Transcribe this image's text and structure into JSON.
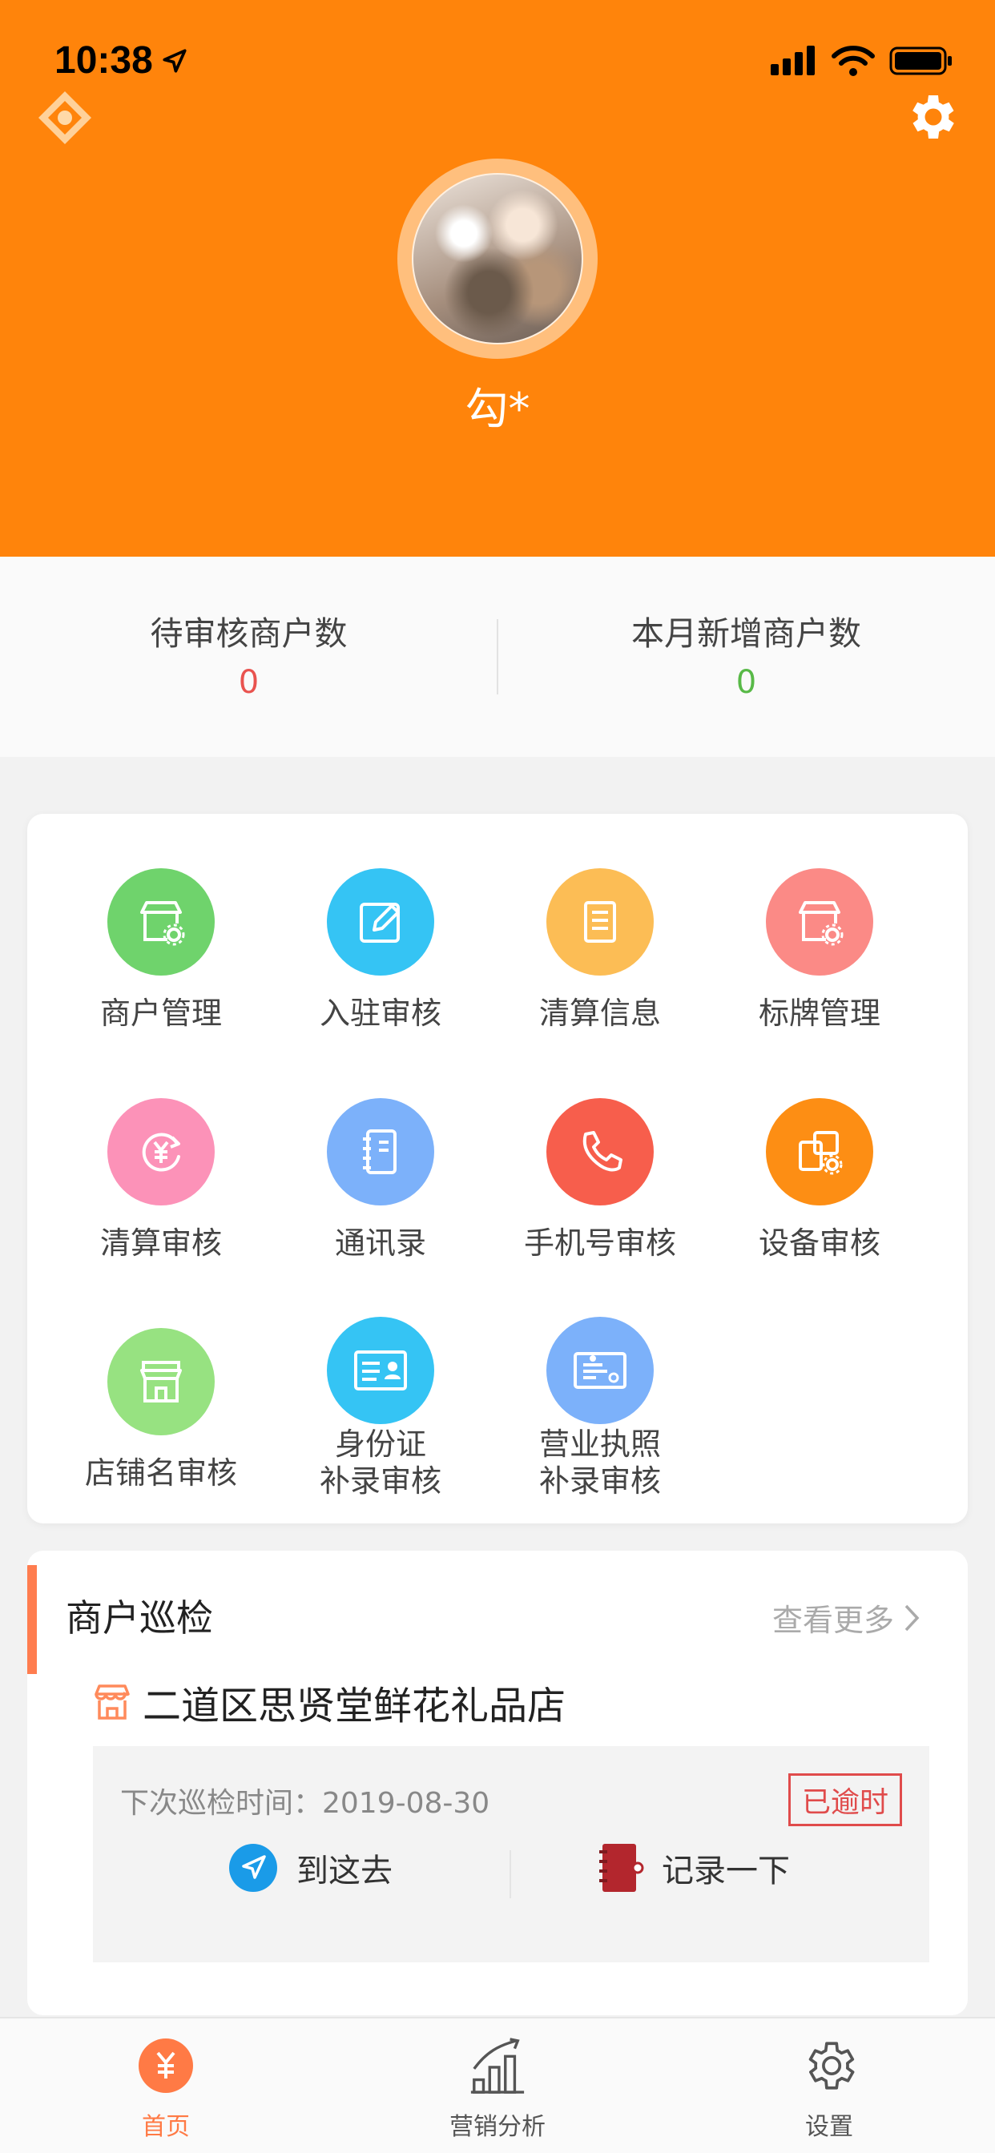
{
  "status_bar": {
    "time": "10:38"
  },
  "profile": {
    "name": "勾*"
  },
  "stats": {
    "pending": {
      "label": "待审核商户数",
      "value": "0"
    },
    "new_this_month": {
      "label": "本月新增商户数",
      "value": "0"
    }
  },
  "colors": {
    "brand": "#ff840b",
    "pending_value": "#e9534f",
    "new_value": "#58b947"
  },
  "grid": {
    "items": [
      {
        "label": "商户管理",
        "icon": "store-gear-icon",
        "color": "#6fd36c"
      },
      {
        "label": "入驻审核",
        "icon": "edit-icon",
        "color": "#35c4f4"
      },
      {
        "label": "清算信息",
        "icon": "document-icon",
        "color": "#fcbd55"
      },
      {
        "label": "标牌管理",
        "icon": "store-gear-icon",
        "color": "#fb8a86"
      },
      {
        "label": "清算审核",
        "icon": "yuan-refresh-icon",
        "color": "#fc92b8"
      },
      {
        "label": "通讯录",
        "icon": "address-book-icon",
        "color": "#7cb1fa"
      },
      {
        "label": "手机号审核",
        "icon": "phone-icon",
        "color": "#f75e4c"
      },
      {
        "label": "设备审核",
        "icon": "device-gear-icon",
        "color": "#fd8e14"
      },
      {
        "label": "店铺名审核",
        "icon": "shopfront-icon",
        "color": "#97e281"
      },
      {
        "label": "身份证\n补录审核",
        "icon": "id-card-icon",
        "color": "#35c4f4"
      },
      {
        "label": "营业执照\n补录审核",
        "icon": "license-icon",
        "color": "#7cb1fa"
      }
    ]
  },
  "inspection": {
    "title": "商户巡检",
    "more": "查看更多",
    "store_name": "二道区思贤堂鲜花礼品店",
    "next_time": "下次巡检时间：2019-08-30",
    "status": "已逾时",
    "go_label": "到这去",
    "record_label": "记录一下"
  },
  "tabbar": {
    "items": [
      {
        "label": "首页",
        "icon": "home-yen-icon",
        "active": true
      },
      {
        "label": "营销分析",
        "icon": "bar-chart-icon",
        "active": false
      },
      {
        "label": "设置",
        "icon": "gear-icon",
        "active": false
      }
    ],
    "active_color": "#ff7a45",
    "inactive_color": "#555555"
  }
}
